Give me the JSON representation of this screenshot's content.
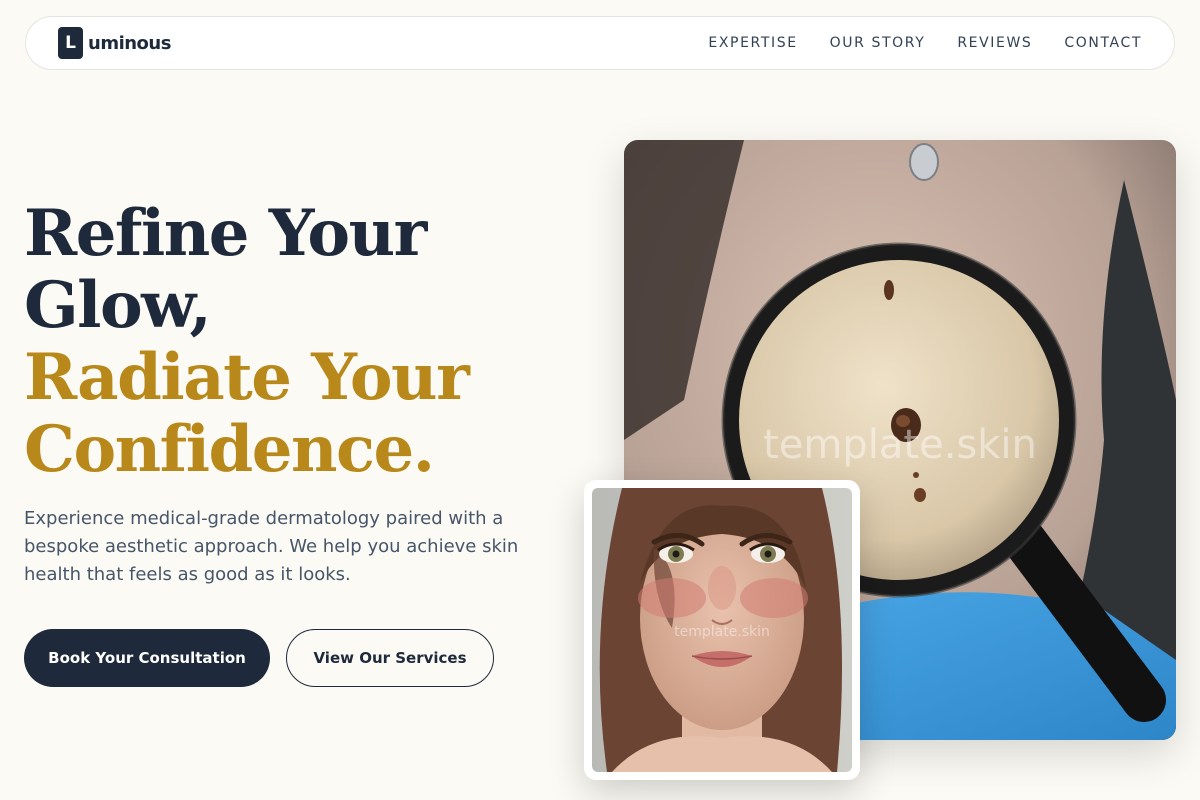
{
  "brand": {
    "mark": "L",
    "name": "uminous"
  },
  "nav": {
    "items": [
      {
        "label": "EXPERTISE"
      },
      {
        "label": "OUR STORY"
      },
      {
        "label": "REVIEWS"
      },
      {
        "label": "CONTACT"
      }
    ]
  },
  "hero": {
    "title_line1": "Refine Your",
    "title_line2": "Glow,",
    "title_line3": "Radiate Your",
    "title_line4": "Confidence.",
    "description": "Experience medical-grade dermatology paired with a bespoke aesthetic approach. We help you achieve skin health that feels as good as it looks.",
    "primary_cta": "Book Your Consultation",
    "secondary_cta": "View Our Services"
  },
  "images": {
    "main_watermark": "template.skin",
    "thumb_watermark": "template.skin"
  },
  "colors": {
    "navy": "#1e293b",
    "gold": "#b8891a",
    "background": "#fbfaf4"
  }
}
